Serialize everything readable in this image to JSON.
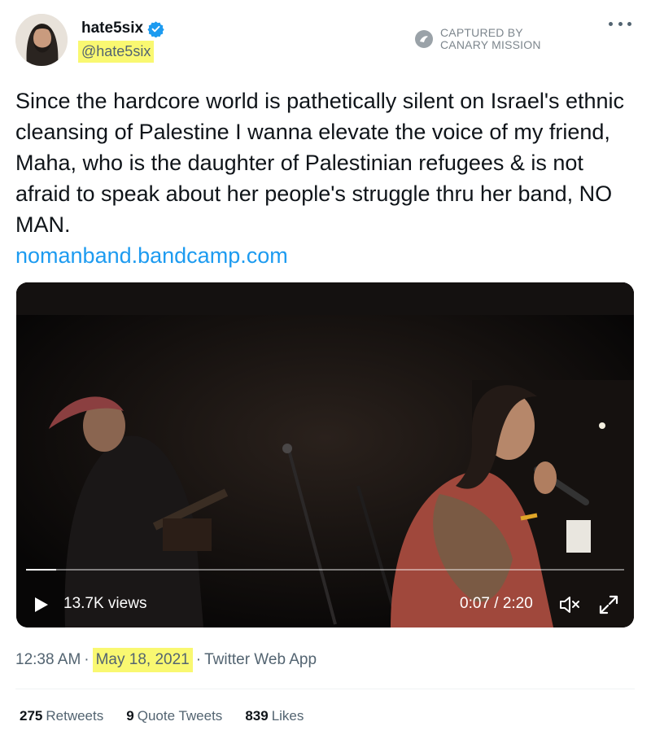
{
  "author": {
    "display_name": "hate5six",
    "handle": "@hate5six",
    "verified": true,
    "avatar_icon": "user-avatar"
  },
  "watermark": {
    "line1": "CAPTURED BY",
    "line2": "CANARY MISSION",
    "icon": "canary-logo-icon"
  },
  "tweet": {
    "text": "Since the hardcore world is pathetically silent on Israel's ethnic cleansing of Palestine I wanna elevate the voice of my friend, Maha, who is the daughter of Palestinian refugees & is not afraid to speak about her people's struggle thru her band, NO MAN.",
    "link": "nomanband.bandcamp.com"
  },
  "video": {
    "views": "13.7K views",
    "time": "0:07 / 2:20",
    "progress_fraction": 0.05
  },
  "meta": {
    "time": "12:38 AM",
    "separator": "·",
    "date": "May 18, 2021",
    "source": "Twitter Web App"
  },
  "stats": {
    "retweets_count": "275",
    "retweets_label": "Retweets",
    "quotes_count": "9",
    "quotes_label": "Quote Tweets",
    "likes_count": "839",
    "likes_label": "Likes"
  },
  "colors": {
    "link": "#1d9bf0",
    "verified": "#1d9bf0",
    "highlight": "#f9f871",
    "secondary_text": "#536471"
  }
}
